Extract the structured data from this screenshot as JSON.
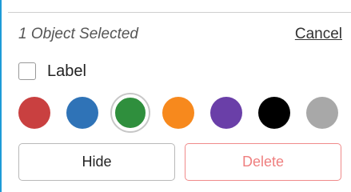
{
  "panel": {
    "selection_text": "1 Object Selected",
    "cancel_label": "Cancel",
    "label_checkbox": {
      "label": "Label",
      "checked": false
    },
    "colors": [
      {
        "name": "red",
        "hex": "#c94040",
        "selected": false
      },
      {
        "name": "blue",
        "hex": "#2f73b7",
        "selected": false
      },
      {
        "name": "green",
        "hex": "#2f8f3d",
        "selected": true
      },
      {
        "name": "orange",
        "hex": "#f7891d",
        "selected": false
      },
      {
        "name": "purple",
        "hex": "#6a3fa8",
        "selected": false
      },
      {
        "name": "black",
        "hex": "#000000",
        "selected": false
      },
      {
        "name": "gray",
        "hex": "#a8a8a8",
        "selected": false
      }
    ],
    "hide_label": "Hide",
    "delete_label": "Delete"
  },
  "theme": {
    "accent_border": "#1e9bd7",
    "delete_color": "#ef7f7f"
  }
}
